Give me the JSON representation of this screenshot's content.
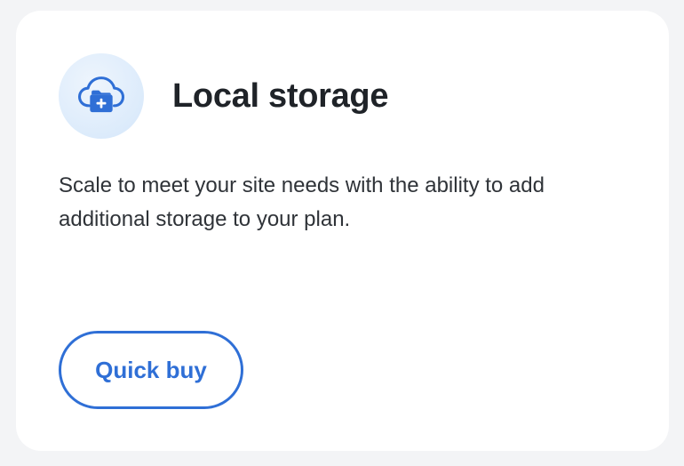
{
  "card": {
    "icon": "cloud-folder-add-icon",
    "title": "Local storage",
    "description": "Scale to meet your site needs with the ability to add additional storage to your plan.",
    "button_label": "Quick buy"
  },
  "colors": {
    "accent": "#2f6fd6",
    "title_text": "#1f2328",
    "body_text": "#2f3338",
    "icon_background": "#dcebfb",
    "page_background": "#f3f4f6",
    "card_background": "#ffffff"
  }
}
